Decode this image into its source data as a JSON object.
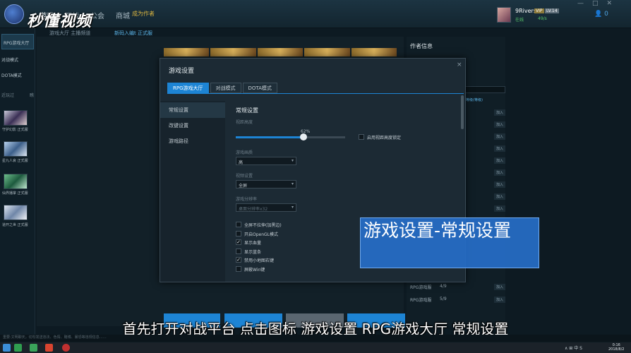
{
  "topbar": {
    "nav": [
      "游戏",
      "观战",
      "公会",
      "商城"
    ],
    "author_badge": "成为作者",
    "watermark": "秒懂视频",
    "subnav_left": "游戏大厅  主播频道",
    "subnav_right": "新码入编t  正式服",
    "user": {
      "name": "9Rivers",
      "vip": "VIP",
      "level": "LV.14",
      "status": "在线",
      "status2": "49/s"
    },
    "friends_count": "0",
    "window_controls": [
      "—",
      "□",
      "✕"
    ]
  },
  "sidebar": {
    "items": [
      {
        "label": "RPG游戏大厅",
        "active": true
      },
      {
        "label": "对战模式",
        "active": false
      },
      {
        "label": "DOTA模式",
        "active": false
      }
    ],
    "section_label": "近玩过",
    "section_right": "瞧",
    "games": [
      {
        "label": "守护幻影 正式服"
      },
      {
        "label": "星九人哀 正式服"
      },
      {
        "label": "仙界播掌 正式服"
      },
      {
        "label": "道开之世 正式服"
      }
    ]
  },
  "right_panel": {
    "title": "作者信息",
    "header_link": "等级(等级)",
    "rows": [
      {
        "label": "RPG游戏服",
        "count": "4/9"
      },
      {
        "label": "RPG游戏服",
        "count": "5/9"
      }
    ],
    "join_label": "加入"
  },
  "dialog": {
    "title": "游戏设置",
    "close": "×",
    "tabs": [
      "RPG游戏大厅",
      "对战模式",
      "DOTA模式"
    ],
    "left_menu": [
      "常规设置",
      "改键设置",
      "游戏路径"
    ],
    "section_title": "常规设置",
    "view_height_label": "视距高度",
    "slider_value": 62,
    "slider_value_text": "62%",
    "lock_checkbox_label": "启用视距高度锁定",
    "quality_label": "游戏画质",
    "quality_value": "高",
    "display_label": "视频设置",
    "display_value": "全屏",
    "resolution_label": "游戏分辨率",
    "resolution_value": "桌面分辨率x32",
    "checkboxes": [
      {
        "label": "全屏不拉伸(加黑边)",
        "checked": false
      },
      {
        "label": "开启OpenGL模式",
        "checked": false
      },
      {
        "label": "显示血量",
        "checked": true
      },
      {
        "label": "显示蓝条",
        "checked": false
      },
      {
        "label": "禁用小地图右键",
        "checked": true
      },
      {
        "label": "屏蔽Win键",
        "checked": false
      }
    ]
  },
  "overlay_caption": "游戏设置-常规设置",
  "subtitle": "首先打开对战平台 点击图标 游戏设置 RPG游戏大厅 常规设置",
  "status_text": "重要:文明聊天，切勿发送违法、色情、赌博、暴恐等违规信息……",
  "taskbar": {
    "tray": "∧  ⊞  中  S",
    "time": "0:16",
    "date": "2018/8/2"
  }
}
